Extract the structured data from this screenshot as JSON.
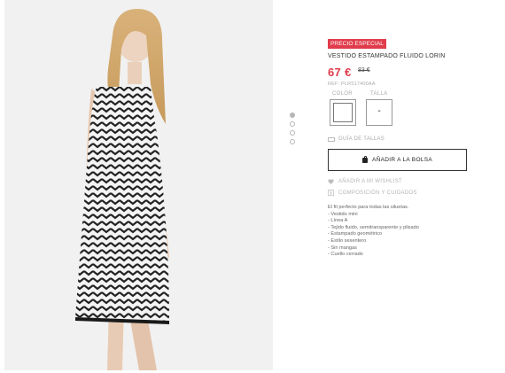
{
  "product": {
    "badge": "PRECIO ESPECIAL",
    "title": "VESTIDO ESTAMPADO FLUIDO LORIN",
    "price_now": "67 €",
    "price_old": "83 €",
    "ref": "REF: PLR517400AA",
    "accent_color": "#e03c4b"
  },
  "options": {
    "color_label": "COLOR",
    "size_label": "TALLA",
    "size_value": "-"
  },
  "size_guide": "GUÍA DE TALLAS",
  "add_to_bag": "AÑADIR A LA BOLSA",
  "wishlist": "AÑADIR A MI WISHLIST",
  "composition": "COMPOSICIÓN Y CUIDADOS",
  "description": {
    "intro": "El fit perfecto para todas las siluetas.",
    "features": [
      "- Vestido mini",
      "- Línea A",
      "- Tejido fluido, semitransparente y plisado",
      "- Estampado geométrico",
      "- Estilo sesentero",
      "- Sin mangas",
      "- Cuello cerrado"
    ]
  },
  "gallery": {
    "count": 4,
    "active": 1
  },
  "icons": {
    "bag": "shopping-bag-icon",
    "heart": "heart-icon",
    "info": "info-icon",
    "ruler": "ruler-icon"
  }
}
